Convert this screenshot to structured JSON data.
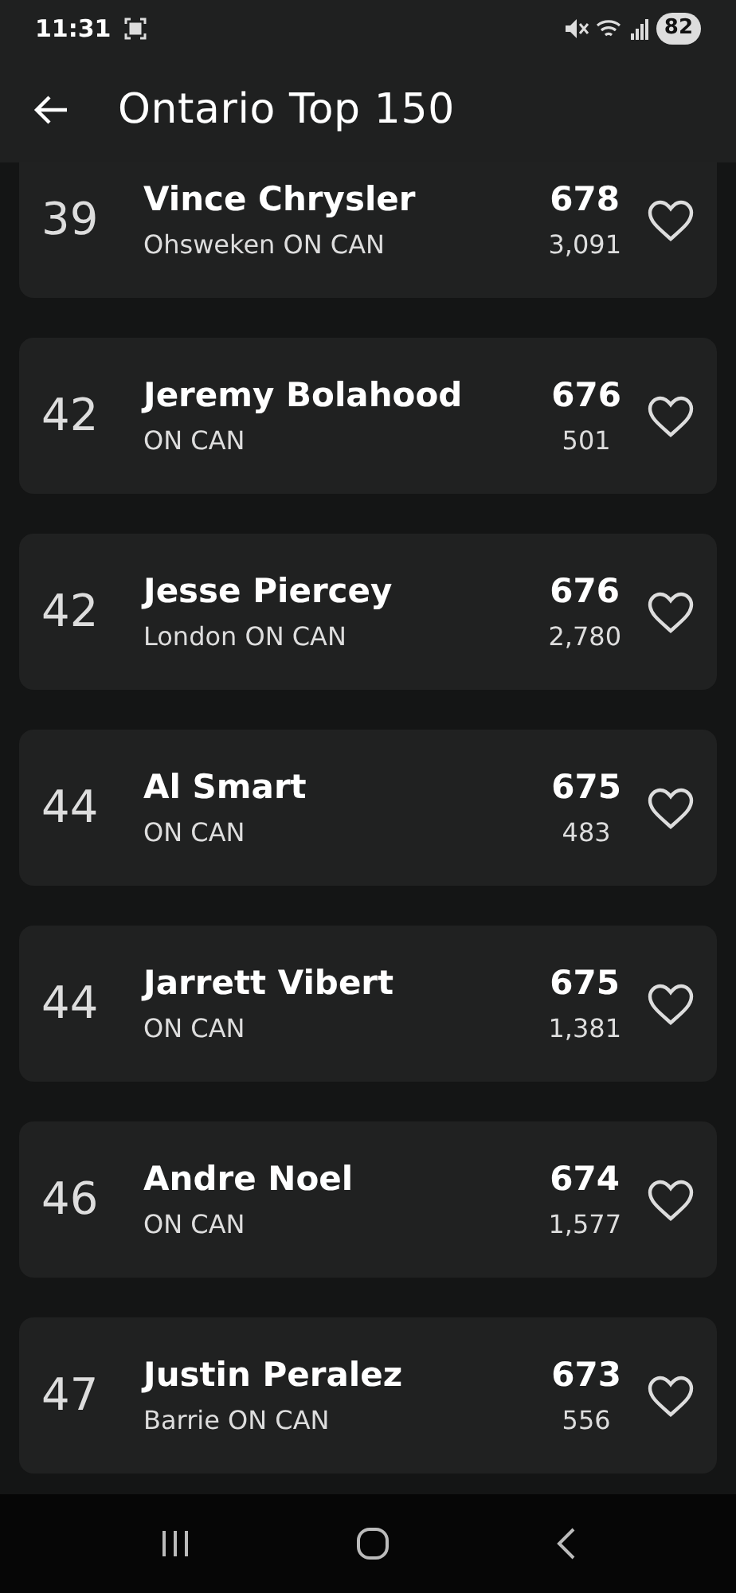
{
  "status_bar": {
    "time": "11:31",
    "battery": "82"
  },
  "app_bar": {
    "title": "Ontario Top 150"
  },
  "players": [
    {
      "rank": "39",
      "name": "Vince Chrysler",
      "location": "Ohsweken ON CAN",
      "rating": "678",
      "points": "3,091",
      "favorite": false
    },
    {
      "rank": "42",
      "name": "Jeremy Bolahood",
      "location": "ON CAN",
      "rating": "676",
      "points": "501",
      "favorite": false
    },
    {
      "rank": "42",
      "name": "Jesse Piercey",
      "location": "London ON CAN",
      "rating": "676",
      "points": "2,780",
      "favorite": false
    },
    {
      "rank": "44",
      "name": "Al Smart",
      "location": "ON CAN",
      "rating": "675",
      "points": "483",
      "favorite": false
    },
    {
      "rank": "44",
      "name": "Jarrett Vibert",
      "location": "ON CAN",
      "rating": "675",
      "points": "1,381",
      "favorite": false
    },
    {
      "rank": "46",
      "name": "Andre Noel",
      "location": "ON CAN",
      "rating": "674",
      "points": "1,577",
      "favorite": false
    },
    {
      "rank": "47",
      "name": "Justin Peralez",
      "location": "Barrie ON CAN",
      "rating": "673",
      "points": "556",
      "favorite": false
    }
  ]
}
